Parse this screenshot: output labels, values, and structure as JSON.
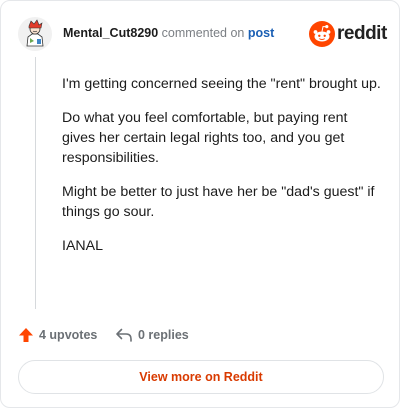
{
  "comment": {
    "username": "Mental_Cut8290",
    "action_text": "commented on",
    "post_link": "post",
    "brand_name": "reddit",
    "paragraphs": [
      "I'm getting concerned seeing the \"rent\" brought up.",
      "Do what you feel comfortable, but paying rent gives her certain legal rights too, and you get responsibilities.",
      "Might be better to just have her be \"dad's guest\" if things go sour.",
      "IANAL"
    ],
    "upvotes_label": "4 upvotes",
    "replies_label": "0 replies",
    "view_more_label": "View more on Reddit"
  },
  "colors": {
    "reddit_orange": "#ff4500",
    "link_blue": "#1a5fb4",
    "cta_text": "#d93a00"
  },
  "icons": {
    "avatar": "user-avatar-illustration",
    "brand": "reddit-snoo-icon",
    "upvote": "upvote-arrow-icon",
    "reply": "reply-arrow-icon"
  }
}
